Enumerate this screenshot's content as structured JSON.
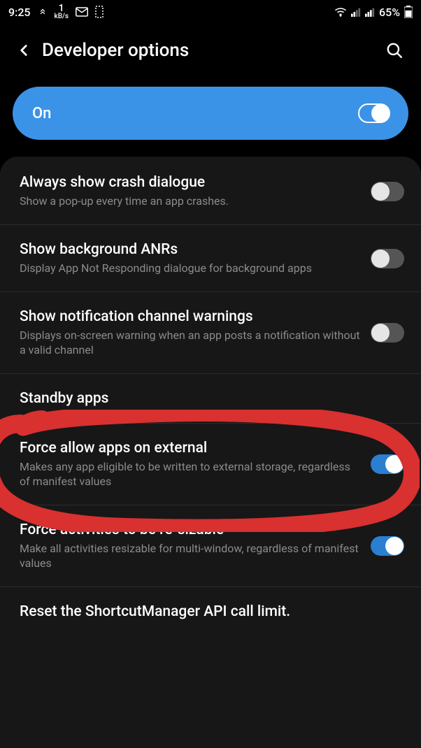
{
  "status": {
    "time": "9:25",
    "kbs_num": "1",
    "kbs_unit": "kB/s",
    "battery": "65%"
  },
  "header": {
    "title": "Developer options"
  },
  "master": {
    "label": "On",
    "enabled": true
  },
  "rows": [
    {
      "id": "always-crash",
      "title": "Always show crash dialogue",
      "sub": "Show a pop-up every time an app crashes.",
      "toggle": false
    },
    {
      "id": "background-anrs",
      "title": "Show background ANRs",
      "sub": "Display App Not Responding dialogue for background apps",
      "toggle": false
    },
    {
      "id": "notif-channel",
      "title": "Show notification channel warnings",
      "sub": "Displays on-screen warning when an app posts a notification without a valid channel",
      "toggle": false
    },
    {
      "id": "standby",
      "title": "Standby apps",
      "sub": "",
      "toggle": null
    },
    {
      "id": "force-external",
      "title": "Force allow apps on external",
      "sub": "Makes any app eligible to be written to external storage, regardless of manifest values",
      "toggle": true
    },
    {
      "id": "force-resizable",
      "title": "Force activities to be re-sizable",
      "sub": "Make all activities resizable for multi-window, regardless of manifest values",
      "toggle": true
    },
    {
      "id": "reset-shortcut",
      "title": "Reset the ShortcutManager API call limit.",
      "sub": "",
      "toggle": null
    }
  ]
}
